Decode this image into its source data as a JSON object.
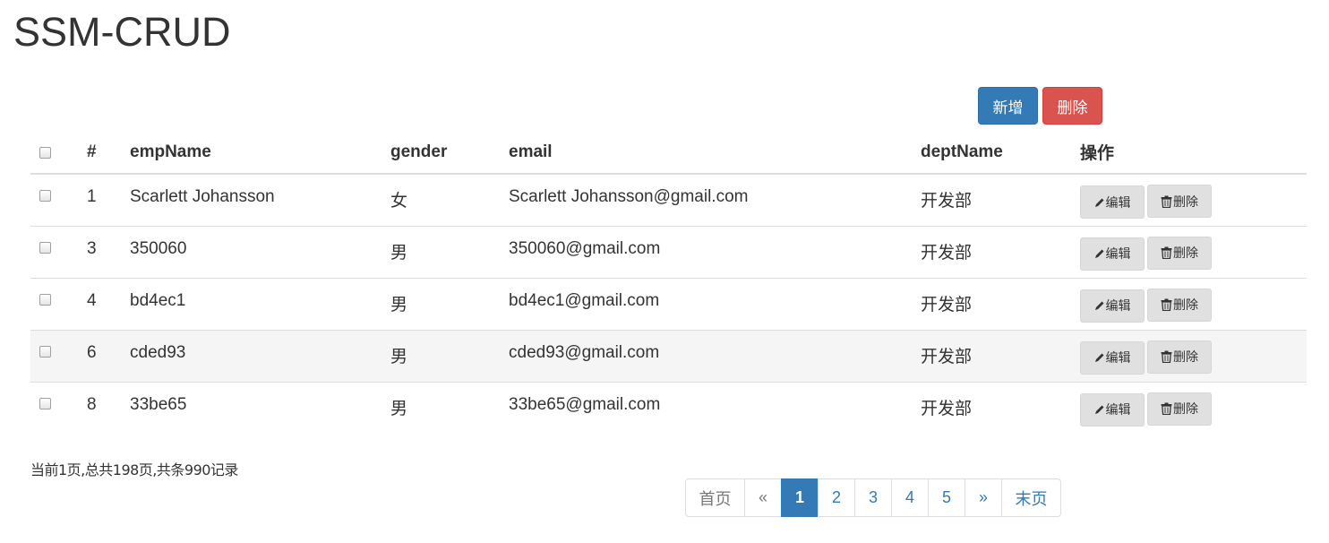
{
  "page": {
    "title": "SSM-CRUD"
  },
  "toolbar": {
    "add_label": "新增",
    "delete_label": "删除"
  },
  "table": {
    "headers": {
      "id": "#",
      "name": "empName",
      "gender": "gender",
      "email": "email",
      "dept": "deptName",
      "ops": "操作"
    },
    "rows": [
      {
        "id": "1",
        "name": "Scarlett Johansson",
        "gender": "女",
        "email": "Scarlett Johansson@gmail.com",
        "dept": "开发部",
        "striped": false
      },
      {
        "id": "3",
        "name": "350060",
        "gender": "男",
        "email": "350060@gmail.com",
        "dept": "开发部",
        "striped": false
      },
      {
        "id": "4",
        "name": "bd4ec1",
        "gender": "男",
        "email": "bd4ec1@gmail.com",
        "dept": "开发部",
        "striped": false
      },
      {
        "id": "6",
        "name": "cded93",
        "gender": "男",
        "email": "cded93@gmail.com",
        "dept": "开发部",
        "striped": true
      },
      {
        "id": "8",
        "name": "33be65",
        "gender": "男",
        "email": "33be65@gmail.com",
        "dept": "开发部",
        "striped": false
      }
    ],
    "row_buttons": {
      "edit_label": "编辑",
      "delete_label": "删除"
    }
  },
  "page_info": "当前1页,总共198页,共条990记录",
  "pagination": {
    "first": "首页",
    "prev": "«",
    "pages": [
      "1",
      "2",
      "3",
      "4",
      "5"
    ],
    "active_page": "1",
    "next": "»",
    "last": "末页"
  },
  "colors": {
    "primary": "#337ab7",
    "danger": "#d9534f",
    "default_btn": "#e0e0e0",
    "stripe": "#f5f5f5"
  },
  "icons": {
    "edit": "pencil-icon",
    "delete": "trash-icon"
  }
}
